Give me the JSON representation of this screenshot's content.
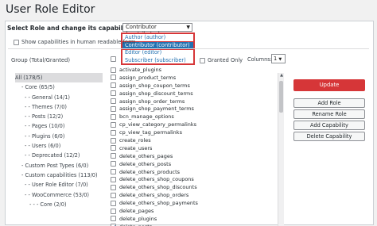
{
  "page": {
    "title": "User Role Editor"
  },
  "role_selector": {
    "label": "Select Role and change its capabilities:",
    "selected": "Contributor (contributor)",
    "options": [
      "Author (author)",
      "Contributor (contributor)",
      "Editor (editor)",
      "Subscriber (subscriber)"
    ]
  },
  "human_readable": {
    "label": "Show capabilities in human readable form"
  },
  "toolbar": {
    "granted_only": "Granted Only",
    "columns_label": "Columns:",
    "columns_value": "1"
  },
  "groups": {
    "header": "Group (Total/Granted)",
    "items": [
      "All (178/5)",
      "- Core (65/5)",
      "- - General (14/1)",
      "- - Themes (7/0)",
      "- - Posts (12/2)",
      "- - Pages (10/0)",
      "- - Plugins (6/0)",
      "- - Users (6/0)",
      "- - Deprecated (12/2)",
      "- Custom Post Types (6/0)",
      "- Custom capabilities (113/0)",
      "- - User Role Editor (7/0)",
      "- - WooCommerce (53/0)",
      "- - - Core (2/0)"
    ]
  },
  "capabilities": [
    "activate_plugins",
    "assign_product_terms",
    "assign_shop_coupon_terms",
    "assign_shop_discount_terms",
    "assign_shop_order_terms",
    "assign_shop_payment_terms",
    "bcn_manage_options",
    "cp_view_category_permalinks",
    "cp_view_tag_permalinks",
    "create_roles",
    "create_users",
    "delete_others_pages",
    "delete_others_posts",
    "delete_others_products",
    "delete_others_shop_coupons",
    "delete_others_shop_discounts",
    "delete_others_shop_orders",
    "delete_others_shop_payments",
    "delete_pages",
    "delete_plugins",
    "delete_posts"
  ],
  "actions": {
    "update": "Update",
    "add_role": "Add Role",
    "rename_role": "Rename Role",
    "add_capability": "Add Capability",
    "delete_capability": "Delete Capability"
  },
  "colors": {
    "accent": "#2271b1",
    "update_button": "#d63638",
    "highlight_border": "#d63638"
  }
}
